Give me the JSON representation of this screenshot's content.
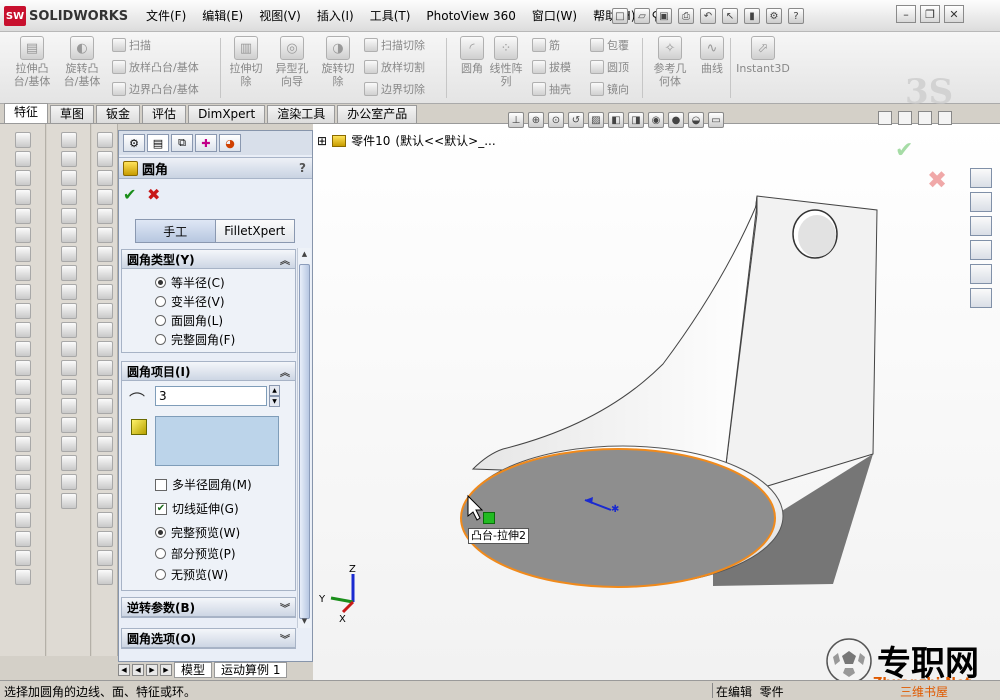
{
  "app": {
    "logo_text": "SOLIDWORKS",
    "logo_badge": "SW"
  },
  "menu": [
    "文件(F)",
    "编辑(E)",
    "视图(V)",
    "插入(I)",
    "工具(T)",
    "PhotoView 360",
    "窗口(W)",
    "帮助(H)"
  ],
  "commands": {
    "extrude_boss": "拉伸凸\n台/基体",
    "revolve_boss": "旋转凸\n台/基体",
    "sweep": "扫描",
    "loft": "放样凸台/基体",
    "boundary": "边界凸台/基体",
    "extrude_cut": "拉伸切\n除",
    "hole_wizard": "异型孔\n向导",
    "revolve_cut": "旋转切\n除",
    "sweep_cut": "扫描切除",
    "loft_cut": "放样切割",
    "boundary_cut": "边界切除",
    "fillet": "圆角",
    "linear_pattern": "线性阵\n列",
    "rib": "筋",
    "draft": "拔模",
    "shell": "抽壳",
    "wrap": "包覆",
    "dome": "圆顶",
    "mirror": "镜向",
    "ref_geometry": "参考几\n何体",
    "curves": "曲线",
    "instant3d": "Instant3D"
  },
  "tabs": [
    "特征",
    "草图",
    "钣金",
    "评估",
    "DimXpert",
    "渲染工具",
    "办公室产品"
  ],
  "property_manager": {
    "title": "圆角",
    "help": "?",
    "ok": "✔",
    "cancel": "✖",
    "mode_manual": "手工",
    "mode_xpert": "FilletXpert",
    "fillet_type": {
      "header": "圆角类型(Y)",
      "options": [
        "等半径(C)",
        "变半径(V)",
        "面圆角(L)",
        "完整圆角(F)"
      ],
      "selected": 0
    },
    "items": {
      "header": "圆角项目(I)",
      "radius_value": "3",
      "multi_radius": "多半径圆角(M)",
      "tangent_propagation": "切线延伸(G)",
      "preview_full": "完整预览(W)",
      "preview_partial": "部分预览(P)",
      "preview_none": "无预览(W)"
    },
    "setback": {
      "header": "逆转参数(B)"
    },
    "options": {
      "header": "圆角选项(O)"
    }
  },
  "bottom_tabs": [
    "模型",
    "运动算例 1"
  ],
  "viewport": {
    "tree_label": "零件10",
    "config_label": "(默认<<默认>_...",
    "tooltip": "凸台-拉伸2"
  },
  "watermark": {
    "main": "专职网",
    "sub": "Zhuanzhi.Net",
    "sub2": "三维书屋"
  },
  "status": {
    "message": "选择加圆角的边线、面、特征或环。",
    "mode": "在编辑",
    "doc": "零件"
  },
  "colors": {
    "selection": "#f08a1c",
    "ok": "#1a8e1a",
    "cancel": "#c81818",
    "highlight": "#bcd4ea"
  }
}
